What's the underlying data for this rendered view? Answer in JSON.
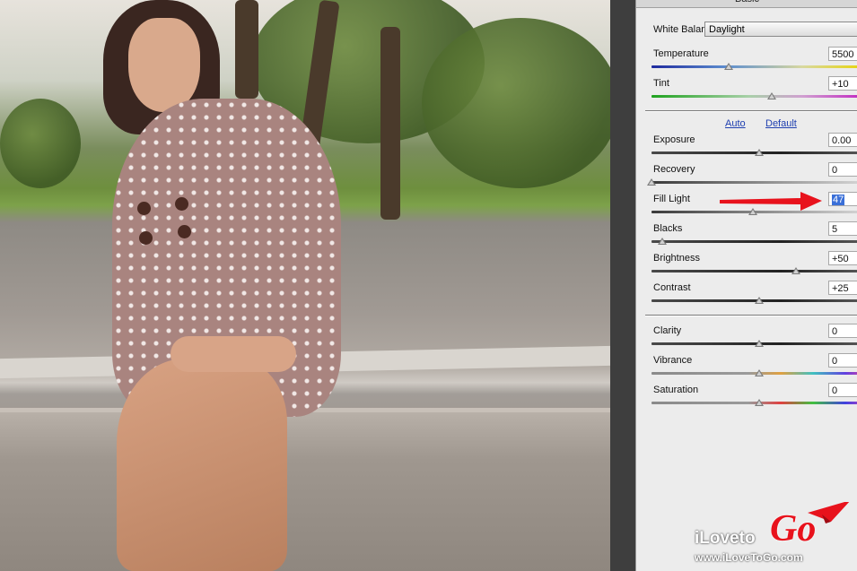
{
  "panel": {
    "title": "Basic",
    "white_balance": {
      "label": "White Balance:",
      "value": "Daylight"
    },
    "auto_label": "Auto",
    "default_label": "Default",
    "controls": [
      {
        "key": "temperature",
        "label": "Temperature",
        "value": "5500",
        "level": 0.36
      },
      {
        "key": "tint",
        "label": "Tint",
        "value": "+10",
        "level": 0.56
      },
      {
        "key": "exposure",
        "label": "Exposure",
        "value": "0.00",
        "level": 0.5
      },
      {
        "key": "recovery",
        "label": "Recovery",
        "value": "0",
        "level": 0.0
      },
      {
        "key": "fill_light",
        "label": "Fill Light",
        "value": "47",
        "level": 0.47,
        "selected": true
      },
      {
        "key": "blacks",
        "label": "Blacks",
        "value": "5",
        "level": 0.05
      },
      {
        "key": "brightness",
        "label": "Brightness",
        "value": "+50",
        "level": 0.67
      },
      {
        "key": "contrast",
        "label": "Contrast",
        "value": "+25",
        "level": 0.5
      },
      {
        "key": "clarity",
        "label": "Clarity",
        "value": "0",
        "level": 0.5
      },
      {
        "key": "vibrance",
        "label": "Vibrance",
        "value": "0",
        "level": 0.5
      },
      {
        "key": "saturation",
        "label": "Saturation",
        "value": "0",
        "level": 0.5
      }
    ]
  },
  "overlay": {
    "arrow_color": "#e8121c",
    "logo_text_main": "iLoveto",
    "logo_text_go": "Go",
    "logo_url": "www.iLoveToGo.com"
  },
  "colors": {
    "accent_red": "#e8121c",
    "link_blue": "#1f3fb0",
    "selection_blue": "#3a6fd8"
  }
}
